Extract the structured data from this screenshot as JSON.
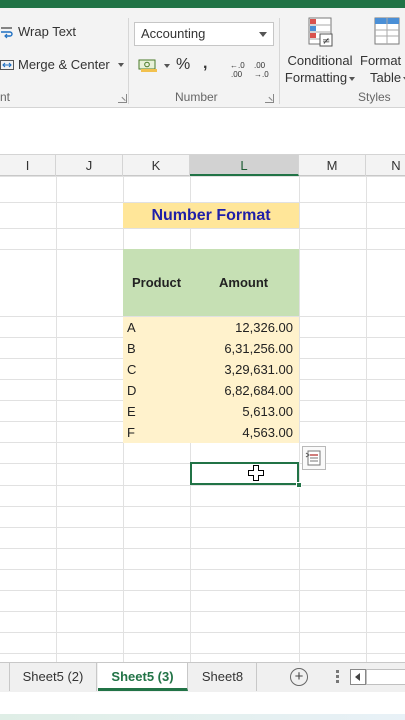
{
  "ribbon": {
    "alignment": {
      "wrap_text_label": "Wrap Text",
      "merge_center_label": "Merge & Center",
      "group_label": "nt"
    },
    "number": {
      "format_value": "Accounting",
      "percent_symbol": "%",
      "comma_symbol": ",",
      "group_label": "Number"
    },
    "styles": {
      "conditional_line1": "Conditional",
      "conditional_line2": "Formatting",
      "format_table_line1": "Format",
      "format_table_line2": "Table",
      "group_label": "Styles"
    }
  },
  "columns": [
    {
      "label": "I",
      "selected": false
    },
    {
      "label": "J",
      "selected": false
    },
    {
      "label": "K",
      "selected": false
    },
    {
      "label": "L",
      "selected": true
    },
    {
      "label": "M",
      "selected": false
    },
    {
      "label": "N",
      "selected": false
    }
  ],
  "sheet": {
    "title": "Number Format",
    "header_product": "Product",
    "header_amount": "Amount",
    "rows": [
      {
        "product": "A",
        "amount": "12,326.00"
      },
      {
        "product": "B",
        "amount": "6,31,256.00"
      },
      {
        "product": "C",
        "amount": "3,29,631.00"
      },
      {
        "product": "D",
        "amount": "6,82,684.00"
      },
      {
        "product": "E",
        "amount": "5,613.00"
      },
      {
        "product": "F",
        "amount": "4,563.00"
      }
    ]
  },
  "tabs": [
    {
      "label": "Sheet5 (2)",
      "active": false
    },
    {
      "label": "Sheet5 (3)",
      "active": true
    },
    {
      "label": "Sheet8",
      "active": false
    }
  ],
  "colors": {
    "excel_green": "#217346",
    "title_fill": "#ffe699",
    "title_text": "#1f1fa8",
    "header_fill": "#c6e0b4",
    "data_fill": "#fff2cc"
  }
}
